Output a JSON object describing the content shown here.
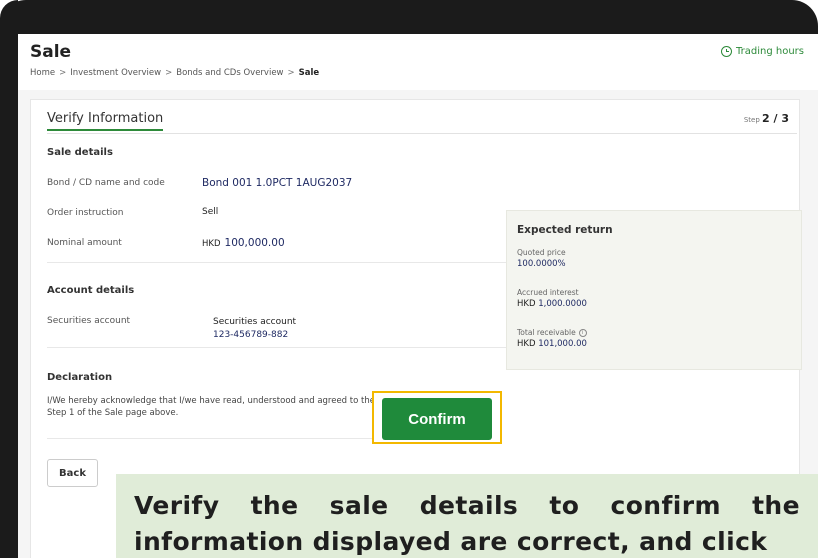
{
  "header": {
    "title": "Sale",
    "trading_hours": "Trading hours",
    "breadcrumb": [
      "Home",
      "Investment Overview",
      "Bonds and CDs Overview",
      "Sale"
    ]
  },
  "card": {
    "title": "Verify Information",
    "step_label": "Step",
    "step_value": "2 / 3"
  },
  "sale_details": {
    "heading": "Sale details",
    "rows": [
      {
        "label": "Bond / CD name and code",
        "value": "Bond 001 1.0PCT 1AUG2037"
      },
      {
        "label": "Order instruction",
        "value": "Sell"
      },
      {
        "label": "Nominal amount",
        "currency": "HKD",
        "value": "100,000.00"
      }
    ]
  },
  "account_details": {
    "heading": "Account details",
    "label": "Securities account",
    "value_title": "Securities account",
    "value_number": "123-456789-882"
  },
  "declaration": {
    "heading": "Declaration",
    "text": "I/We hereby acknowledge that I/we have read, understood and agreed to the declaration I/we made in Step 1 of the Sale page above."
  },
  "buttons": {
    "back": "Back",
    "confirm": "Confirm"
  },
  "expected_return": {
    "title": "Expected return",
    "quoted_price_label": "Quoted price",
    "quoted_price_value": "100.0000%",
    "accrued_interest_label": "Accrued interest",
    "accrued_interest_currency": "HKD",
    "accrued_interest_value": "1,000.0000",
    "total_receivable_label": "Total receivable",
    "total_receivable_currency": "HKD",
    "total_receivable_value": "101,000.00"
  },
  "caption": {
    "text": "Verify the sale details to confirm the information displayed are correct, and click"
  },
  "colors": {
    "accent_green": "#1f8a3b",
    "highlight_yellow": "#f3b800",
    "caption_bg": "#e0ecd8",
    "value_navy": "#1f2a63"
  }
}
